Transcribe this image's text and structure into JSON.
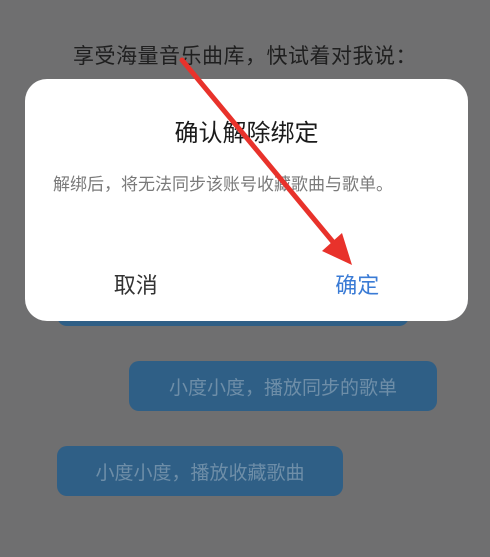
{
  "background": {
    "hint_text": "享受海量音乐曲库，快试着对我说：",
    "bubbles": [
      "小度小度，播放同步的歌单",
      "小度小度，播放收藏歌曲"
    ]
  },
  "dialog": {
    "title": "确认解除绑定",
    "message": "解绑后，将无法同步该账号收藏歌曲与歌单。",
    "cancel_label": "取消",
    "confirm_label": "确定"
  },
  "colors": {
    "overlay": "#6f6f70",
    "confirm_text": "#3a7bd5",
    "annotation_arrow": "#e8322b",
    "bubble": "#2f5f86"
  },
  "annotation": {
    "icon": "red-arrow-icon"
  }
}
